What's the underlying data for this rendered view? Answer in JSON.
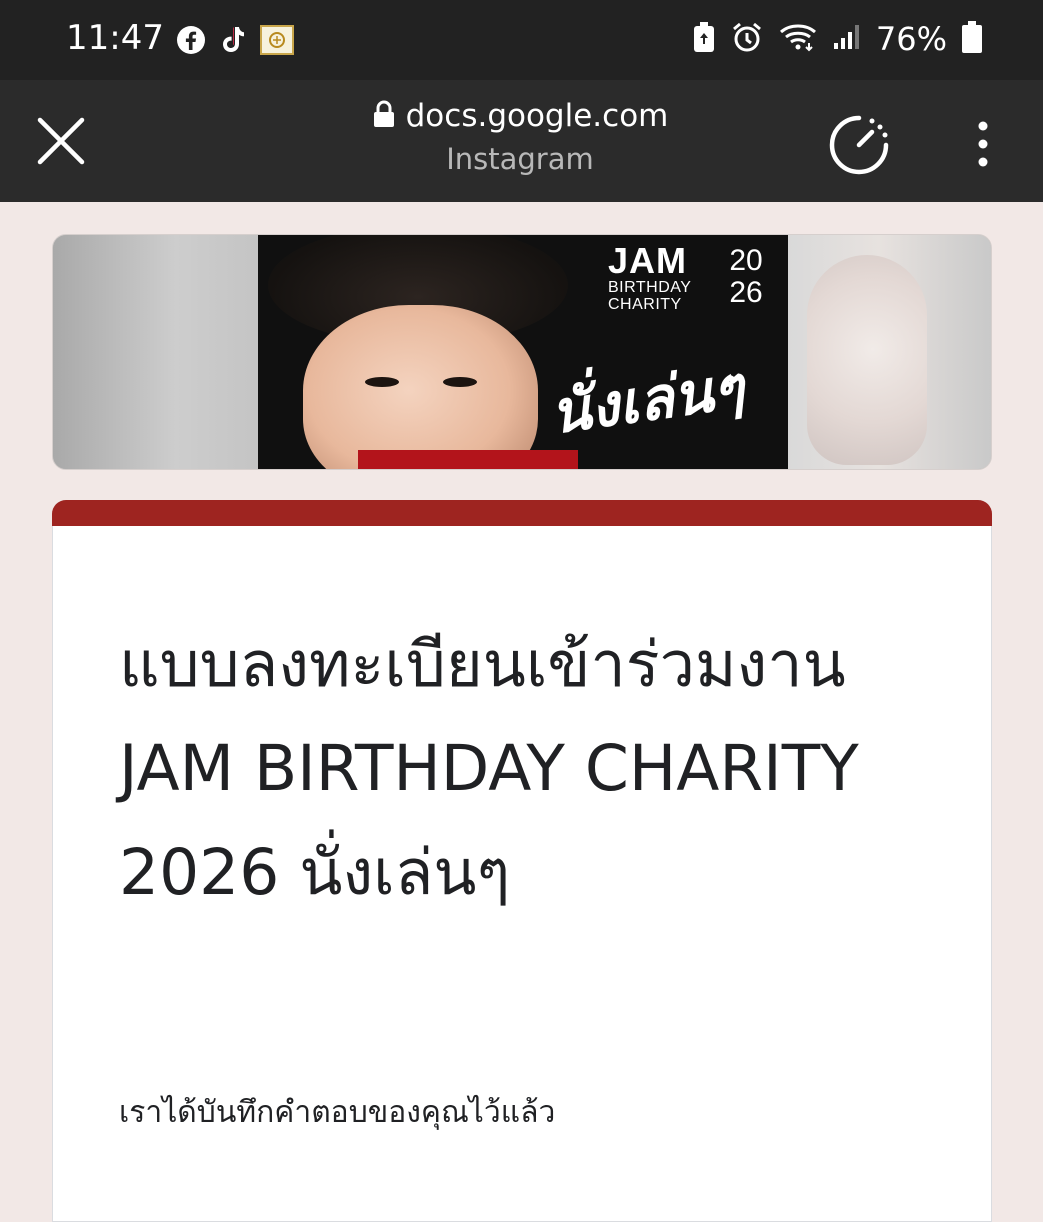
{
  "status_bar": {
    "time": "11:47",
    "left_icons": [
      "facebook-icon",
      "tiktok-icon",
      "app-badge-icon"
    ],
    "right_icons": [
      "battery-saver-icon",
      "alarm-icon",
      "wifi-icon",
      "signal-icon",
      "battery-icon"
    ],
    "battery_percent": "76%"
  },
  "browser": {
    "url": "docs.google.com",
    "source_app": "Instagram",
    "icons": [
      "close-icon",
      "lock-icon",
      "data-saver-icon",
      "more-vert-icon"
    ]
  },
  "banner": {
    "logo_word": "JAM",
    "logo_line1": "BIRTHDAY",
    "logo_line2": "CHARITY",
    "logo_year_top": "20",
    "logo_year_bottom": "26",
    "script_text": "นั่งเล่นๆ"
  },
  "form": {
    "title": "แบบลงทะเบียนเข้าร่วมงาน JAM BIRTHDAY CHARITY 2026 นั่งเล่นๆ",
    "confirmation": "เราได้บันทึกคำตอบของคุณไว้แล้ว",
    "accent_color": "#9e2420"
  },
  "colors": {
    "status_bar": "#222222",
    "toolbar": "#2b2b2b",
    "page_background": "#f2e8e6"
  }
}
